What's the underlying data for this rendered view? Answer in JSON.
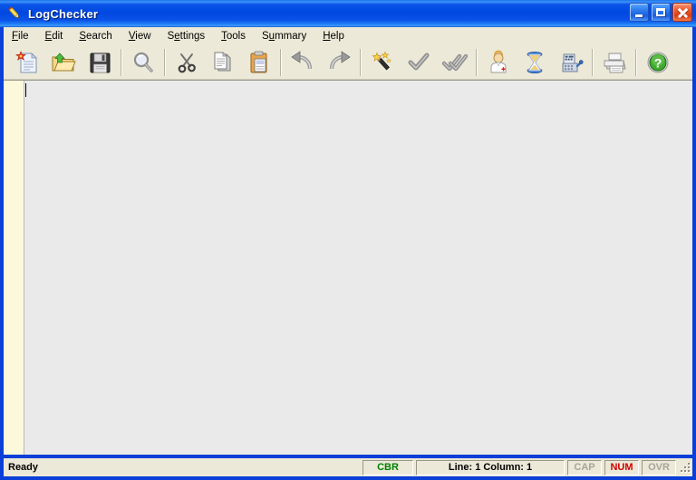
{
  "window": {
    "title": "LogChecker",
    "icon": "pencil-icon",
    "controls": {
      "minimize": "Minimize",
      "maximize": "Maximize",
      "close": "Close"
    }
  },
  "menubar": {
    "items": [
      {
        "label": "File",
        "mnemonic": "F"
      },
      {
        "label": "Edit",
        "mnemonic": "E"
      },
      {
        "label": "Search",
        "mnemonic": "S"
      },
      {
        "label": "View",
        "mnemonic": "V"
      },
      {
        "label": "Settings",
        "mnemonic": "e"
      },
      {
        "label": "Tools",
        "mnemonic": "T"
      },
      {
        "label": "Summary",
        "mnemonic": "u"
      },
      {
        "label": "Help",
        "mnemonic": "H"
      }
    ]
  },
  "toolbar": {
    "buttons": [
      {
        "name": "new-file-button",
        "icon": "new-document-icon",
        "label": "New"
      },
      {
        "name": "open-file-button",
        "icon": "open-folder-icon",
        "label": "Open"
      },
      {
        "name": "save-file-button",
        "icon": "floppy-disk-icon",
        "label": "Save"
      },
      {
        "name": "find-button",
        "icon": "magnifier-icon",
        "label": "Find"
      },
      {
        "name": "cut-button",
        "icon": "scissors-icon",
        "label": "Cut"
      },
      {
        "name": "copy-button",
        "icon": "copy-pages-icon",
        "label": "Copy"
      },
      {
        "name": "paste-button",
        "icon": "clipboard-icon",
        "label": "Paste"
      },
      {
        "name": "undo-button",
        "icon": "undo-arrow-icon",
        "label": "Undo"
      },
      {
        "name": "redo-button",
        "icon": "redo-arrow-icon",
        "label": "Redo"
      },
      {
        "name": "magic-wand-button",
        "icon": "magic-wand-icon",
        "label": "Auto Format"
      },
      {
        "name": "check-button",
        "icon": "check-single-icon",
        "label": "Check"
      },
      {
        "name": "check-all-button",
        "icon": "check-double-icon",
        "label": "Check All"
      },
      {
        "name": "doctor-button",
        "icon": "doctor-icon",
        "label": "Diagnose"
      },
      {
        "name": "hourglass-button",
        "icon": "hourglass-icon",
        "label": "Wait"
      },
      {
        "name": "register-button",
        "icon": "cash-register-icon",
        "label": "Calculate"
      },
      {
        "name": "print-button",
        "icon": "printer-icon",
        "label": "Print"
      },
      {
        "name": "help-button",
        "icon": "help-question-icon",
        "label": "Help"
      }
    ]
  },
  "editor": {
    "content": "",
    "gutter_color": "#fbf8dc",
    "background_color": "#eaeaea"
  },
  "statusbar": {
    "ready": "Ready",
    "cbr": "CBR",
    "position": "Line: 1  Column: 1",
    "cap": "CAP",
    "num": "NUM",
    "ovr": "OVR",
    "colors": {
      "cbr": "#008000",
      "num": "#d00000",
      "inactive": "#a8a49a"
    }
  }
}
